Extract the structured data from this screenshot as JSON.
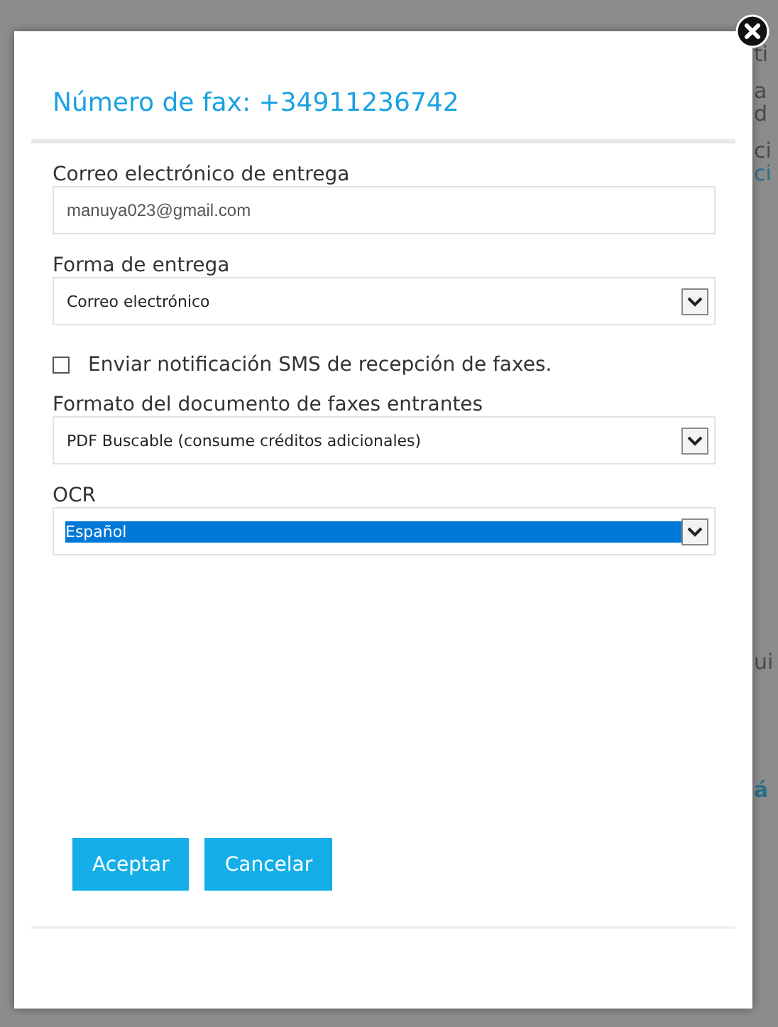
{
  "background_fragments": [
    {
      "text": "ti",
      "kind": "text"
    },
    {
      "text": "a",
      "kind": "text"
    },
    {
      "text": "d",
      "kind": "text"
    },
    {
      "text": "ci",
      "kind": "text"
    },
    {
      "text": "ci",
      "kind": "link"
    },
    {
      "text": "ui",
      "kind": "text"
    },
    {
      "text": "á",
      "kind": "heading"
    }
  ],
  "dialog": {
    "title": "Número de fax: +34911236742",
    "fields": [
      {
        "kind": "input",
        "label": "Correo electrónico de entrega",
        "value": "manuya023@gmail.com"
      },
      {
        "kind": "select",
        "label": "Forma de entrega",
        "value": "Correo electrónico",
        "selected": false
      },
      {
        "kind": "checkbox",
        "label": "Enviar notificación SMS de recepción de faxes.",
        "checked": false
      },
      {
        "kind": "select",
        "label": "Formato del documento de faxes entrantes",
        "value": "PDF Buscable (consume créditos adicionales)",
        "selected": false
      },
      {
        "kind": "select",
        "label": "OCR",
        "value": "Español",
        "selected": true
      }
    ],
    "buttons": [
      "Aceptar",
      "Cancelar"
    ]
  }
}
